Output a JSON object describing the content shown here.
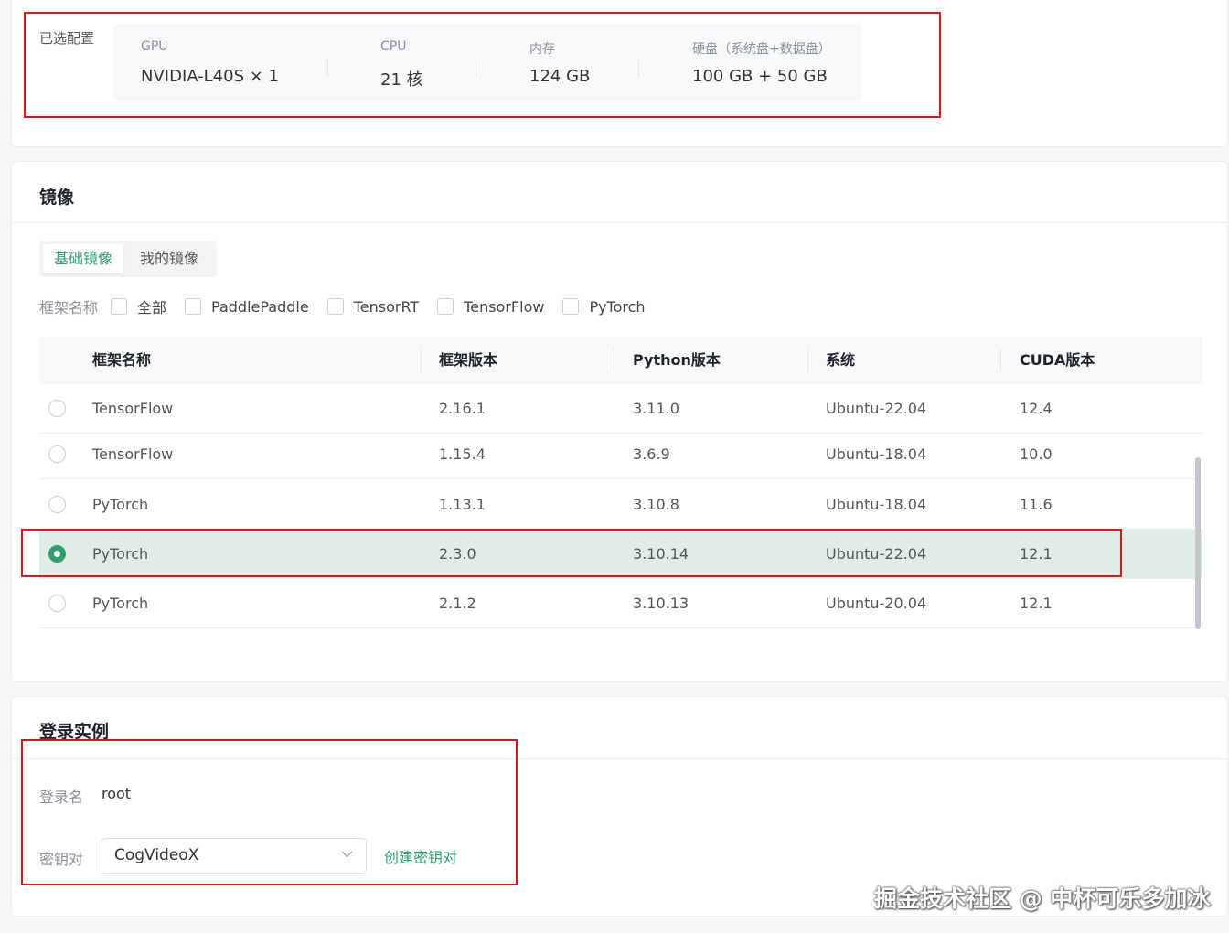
{
  "config": {
    "label": "已选配置",
    "items": [
      {
        "key": "GPU",
        "value": "NVIDIA-L40S × 1"
      },
      {
        "key": "CPU",
        "value": "21 核"
      },
      {
        "key": "内存",
        "value": "124 GB"
      },
      {
        "key": "硬盘（系统盘+数据盘）",
        "value": "100 GB + 50 GB"
      }
    ]
  },
  "image": {
    "title": "镜像",
    "tabs": [
      {
        "label": "基础镜像",
        "active": true
      },
      {
        "label": "我的镜像",
        "active": false
      }
    ],
    "filter": {
      "label": "框架名称",
      "options": [
        "全部",
        "PaddlePaddle",
        "TensorRT",
        "TensorFlow",
        "PyTorch"
      ]
    },
    "table": {
      "headers": [
        "框架名称",
        "框架版本",
        "Python版本",
        "系统",
        "CUDA版本"
      ],
      "rows": [
        {
          "framework": "TensorFlow",
          "version": "2.16.1",
          "python": "3.11.0",
          "os": "Ubuntu-22.04",
          "cuda": "12.4",
          "selected": false
        },
        {
          "framework": "TensorFlow",
          "version": "1.15.4",
          "python": "3.6.9",
          "os": "Ubuntu-18.04",
          "cuda": "10.0",
          "selected": false
        },
        {
          "framework": "PyTorch",
          "version": "1.13.1",
          "python": "3.10.8",
          "os": "Ubuntu-18.04",
          "cuda": "11.6",
          "selected": false
        },
        {
          "framework": "PyTorch",
          "version": "2.3.0",
          "python": "3.10.14",
          "os": "Ubuntu-22.04",
          "cuda": "12.1",
          "selected": true
        },
        {
          "framework": "PyTorch",
          "version": "2.1.2",
          "python": "3.10.13",
          "os": "Ubuntu-20.04",
          "cuda": "12.1",
          "selected": false
        }
      ]
    }
  },
  "login": {
    "title": "登录实例",
    "username_label": "登录名",
    "username_value": "root",
    "keypair_label": "密钥对",
    "keypair_value": "CogVideoX",
    "create_keypair_link": "创建密钥对"
  },
  "watermark": "掘金技术社区 @ 中杯可乐多加冰",
  "colors": {
    "accent": "#2f9e6c",
    "highlight": "#e0141d",
    "selected_row": "#e0ede6"
  }
}
